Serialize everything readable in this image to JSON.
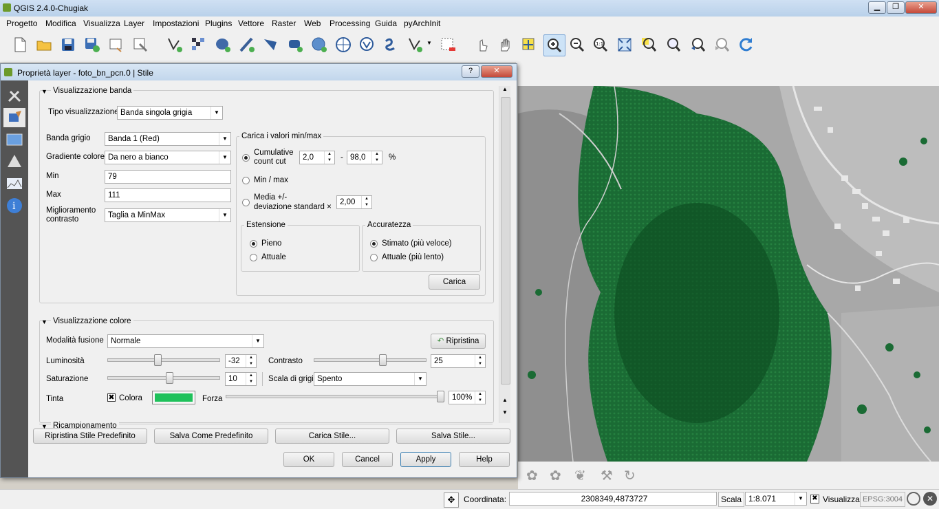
{
  "app": {
    "title": "QGIS 2.4.0-Chugiak"
  },
  "menu": [
    "Progetto",
    "Modifica",
    "Visualizza",
    "Layer",
    "Impostazioni",
    "Plugins",
    "Vettore",
    "Raster",
    "Web",
    "Processing",
    "Guida",
    "pyArchInit"
  ],
  "dialog": {
    "title": "Proprietà layer - foto_bn_pcn.0 | Stile",
    "help_glyph": "?",
    "close_glyph": "✕",
    "band": {
      "section_title": "Visualizzazione banda",
      "render_type_label": "Tipo visualizzazione",
      "render_type_value": "Banda singola grigia",
      "gray_band_label": "Banda grigio",
      "gray_band_value": "Banda 1 (Red)",
      "gradient_label": "Gradiente colore",
      "gradient_value": "Da nero a bianco",
      "min_label": "Min",
      "min_value": "79",
      "max_label": "Max",
      "max_value": "111",
      "contrast_label_1": "Miglioramento",
      "contrast_label_2": "contrasto",
      "contrast_value": "Taglia a MinMax"
    },
    "minmax": {
      "title": "Carica i valori min/max",
      "cumulative_label_1": "Cumulative",
      "cumulative_label_2": "count cut",
      "cum_low": "2,0",
      "dash": "-",
      "cum_high": "98,0",
      "percent": "%",
      "minmax_label": "Min / max",
      "mean_label_1": "Media +/-",
      "mean_label_2": "deviazione standard ×",
      "stddev_value": "2,00",
      "extent_title": "Estensione",
      "extent_full": "Pieno",
      "extent_current": "Attuale",
      "accuracy_title": "Accuratezza",
      "accuracy_estimate": "Stimato (più veloce)",
      "accuracy_actual": "Attuale (più lento)",
      "load_button": "Carica"
    },
    "color": {
      "section_title": "Visualizzazione colore",
      "blend_label": "Modalità fusione",
      "blend_value": "Normale",
      "reset_button": "Ripristina",
      "brightness_label": "Luminosità",
      "brightness_value": "-32",
      "brightness_level": 0.44,
      "contrast_label": "Contrasto",
      "contrast_value": "25",
      "contrast_level": 0.62,
      "saturation_label": "Saturazione",
      "saturation_value": "10",
      "saturation_level": 0.55,
      "grayscale_label": "Scala di grigi",
      "grayscale_value": "Spento",
      "hue_label": "Tinta",
      "colorize_label": "Colora",
      "colorize_color": "#1fc15b",
      "strength_label": "Forza",
      "strength_value": "100%",
      "strength_level": 1.0
    },
    "resampling": {
      "section_title": "Ricampionamento"
    },
    "style_buttons": [
      "Ripristina Stile Predefinito",
      "Salva Come Predefinito",
      "Carica Stile...",
      "Salva Stile..."
    ],
    "buttons": {
      "ok": "OK",
      "cancel": "Cancel",
      "apply": "Apply",
      "help": "Help"
    }
  },
  "status": {
    "coord_label": "Coordinata:",
    "coord_value": "2308349,4873727",
    "scale_label": "Scala",
    "scale_value": "1:8.071",
    "render_label": "Visualizza",
    "crs": "EPSG:3004"
  },
  "colors": {
    "vegetation": "#1a6b34",
    "accent": "#3a7bd5"
  }
}
